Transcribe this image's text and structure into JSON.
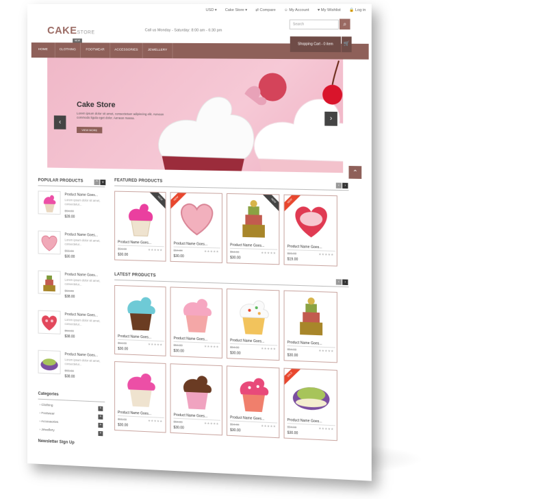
{
  "topbar": {
    "currency": "USD",
    "store": "Cake Store",
    "compare": "Compare",
    "account": "My Account",
    "wishlist": "My Wishlist",
    "login": "Log in"
  },
  "header": {
    "logo_main": "CAKE",
    "logo_sub": "STORE",
    "hours": "Call us Monday - Saturday: 8:00 am - 6:30 pm",
    "search_placeholder": "Search",
    "cart_label": "Shopping Cart - 0 item"
  },
  "nav": {
    "items": [
      {
        "label": "Home"
      },
      {
        "label": "Clothing"
      },
      {
        "label": "Footwear"
      },
      {
        "label": "Accessories"
      },
      {
        "label": "Jewellery"
      }
    ],
    "badge": "NEW"
  },
  "banner": {
    "title": "Cake Store",
    "text": "Lorem ipsum dolor sit amet, consectetuer adipiscing elit. Aenean commodo ligula eget dolor. Aenean massa.",
    "button": "VIEW MORE"
  },
  "popular": {
    "title": "Popular Products",
    "items": [
      {
        "name": "Product Name Goes...",
        "desc": "Lorem ipsum dolor sit amet, consectetur...",
        "old": "$54.00",
        "price": "$28.00"
      },
      {
        "name": "Product Name Goes...",
        "desc": "Lorem ipsum dolor sit amet, consectetur...",
        "old": "$55.00",
        "price": "$30.00"
      },
      {
        "name": "Product Name Goes...",
        "desc": "Lorem ipsum dolor sit amet, consectetur...",
        "old": "$54.00",
        "price": "$38.00"
      },
      {
        "name": "Product Name Goes...",
        "desc": "Lorem ipsum dolor sit amet, consectetur...",
        "old": "$54.00",
        "price": "$38.00"
      },
      {
        "name": "Product Name Goes...",
        "desc": "Lorem ipsum dolor sit amet, consectetur...",
        "old": "$55.00",
        "price": "$38.00"
      }
    ]
  },
  "featured": {
    "title": "Featured Products",
    "items": [
      {
        "name": "Product Name Goes...",
        "old": "$54.00",
        "price": "$30.00",
        "ribbon": "NEW"
      },
      {
        "name": "Product Name Goes...",
        "old": "$54.00",
        "price": "$30.00",
        "ribbon": "NEW"
      },
      {
        "name": "Product Name Goes...",
        "old": "$54.00",
        "price": "$30.00",
        "ribbon": "NEW"
      },
      {
        "name": "Product Name Goes...",
        "old": "$26.00",
        "price": "$19.00",
        "ribbon": "NEW"
      }
    ]
  },
  "latest": {
    "title": "Latest Products",
    "items": [
      {
        "name": "Product Name Goes...",
        "old": "$54.00",
        "price": "$30.00"
      },
      {
        "name": "Product Name Goes...",
        "old": "$54.00",
        "price": "$30.00"
      },
      {
        "name": "Product Name Goes...",
        "old": "$54.00",
        "price": "$30.00"
      },
      {
        "name": "Product Name Goes...",
        "old": "$54.00",
        "price": "$30.00"
      },
      {
        "name": "Product Name Goes...",
        "old": "$56.00",
        "price": "$30.00"
      },
      {
        "name": "Product Name Goes...",
        "old": "$54.00",
        "price": "$30.00"
      },
      {
        "name": "Product Name Goes...",
        "old": "$54.00",
        "price": "$30.00"
      },
      {
        "name": "Product Name Goes...",
        "old": "$54.00",
        "price": "$30.00"
      }
    ],
    "sale_badge": "SALE"
  },
  "categories": {
    "title": "Categories",
    "items": [
      {
        "label": "Clothing"
      },
      {
        "label": "Footwear"
      },
      {
        "label": "Accessories"
      },
      {
        "label": "Jewellery"
      }
    ]
  },
  "newsletter": {
    "title": "Newsletter Sign Up"
  },
  "colors": {
    "brand": "#8e6059",
    "accent": "#e8472e",
    "banner": "#f3bfcf"
  }
}
